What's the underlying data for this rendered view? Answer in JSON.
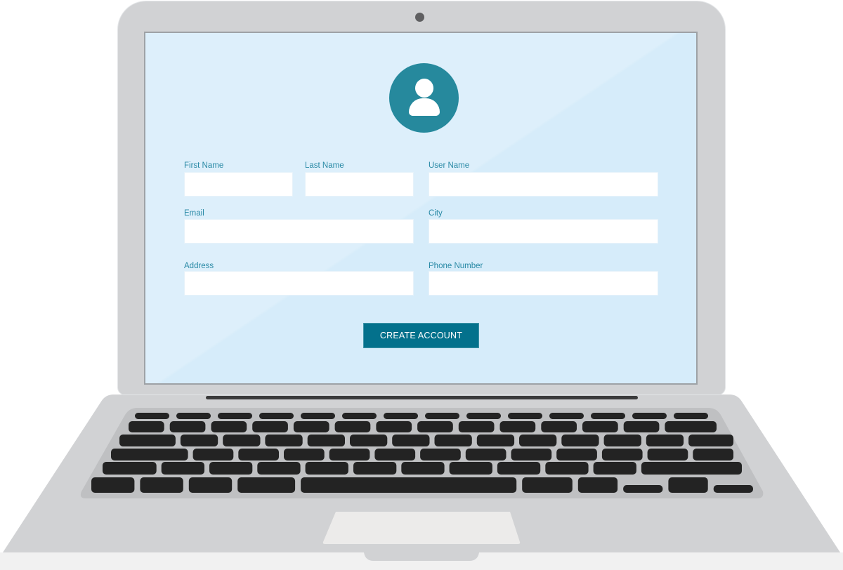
{
  "form": {
    "avatar_icon": "user-icon",
    "fields": [
      {
        "label": "First Name",
        "value": "",
        "placeholder": ""
      },
      {
        "label": "Last Name",
        "value": "",
        "placeholder": ""
      },
      {
        "label": "User Name",
        "value": "",
        "placeholder": ""
      },
      {
        "label": "Email",
        "value": "",
        "placeholder": ""
      },
      {
        "label": "City",
        "value": "",
        "placeholder": ""
      },
      {
        "label": "Address",
        "value": "",
        "placeholder": ""
      },
      {
        "label": "Phone Number",
        "value": "",
        "placeholder": ""
      }
    ],
    "submit_label": "CREATE ACCOUNT"
  },
  "colors": {
    "screen_bg": "#d6ecfa",
    "accent": "#03718c",
    "avatar": "#26899d",
    "label": "#2a8aa6",
    "laptop_body": "#d1d2d4",
    "keys": "#232323"
  }
}
